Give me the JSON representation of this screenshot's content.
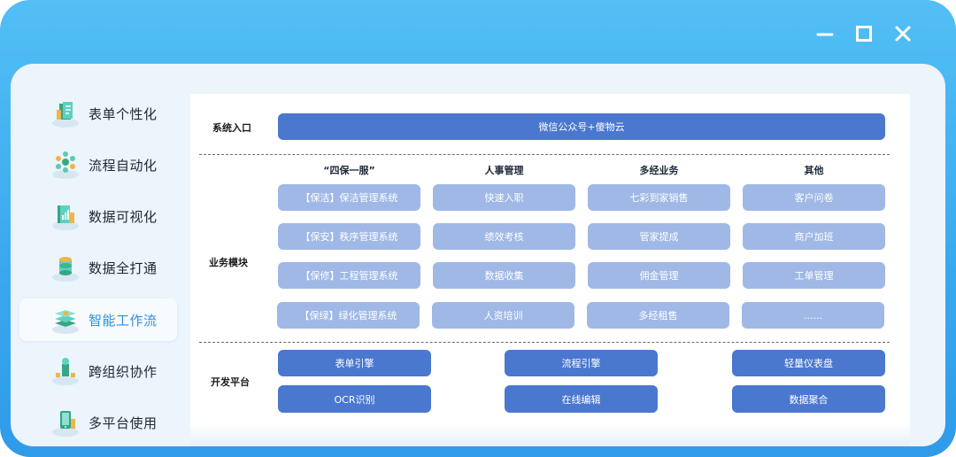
{
  "window_controls": {
    "minimize": "minimize-icon",
    "maximize": "maximize-icon",
    "close": "close-icon"
  },
  "sidebar": {
    "active_color": "#2f8ee6",
    "items": [
      {
        "label": "表单个性化",
        "icon": "form-icon"
      },
      {
        "label": "流程自动化",
        "icon": "workflow-nodes-icon"
      },
      {
        "label": "数据可视化",
        "icon": "chart-book-icon"
      },
      {
        "label": "数据全打通",
        "icon": "database-icon"
      },
      {
        "label": "智能工作流",
        "icon": "layers-icon",
        "active": true
      },
      {
        "label": "跨组织协作",
        "icon": "org-person-icon"
      },
      {
        "label": "多平台使用",
        "icon": "mobile-icon"
      }
    ]
  },
  "architecture": {
    "entry": {
      "label": "系统入口",
      "bar": "微信公众号+傻物云"
    },
    "business": {
      "label": "业务模块",
      "columns": [
        {
          "title": "“四保一服”",
          "items": [
            "【保洁】保洁管理系统",
            "【保安】秩序管理系统",
            "【保修】工程管理系统",
            "【保绿】绿化管理系统"
          ]
        },
        {
          "title": "人事管理",
          "items": [
            "快速入职",
            "绩效考核",
            "数据收集",
            "人资培训"
          ]
        },
        {
          "title": "多经业务",
          "items": [
            "七彩到家销售",
            "管家提成",
            "佣金管理",
            "多经租售"
          ]
        },
        {
          "title": "其他",
          "items": [
            "客户问卷",
            "商户加班",
            "工单管理",
            "......"
          ]
        }
      ]
    },
    "dev": {
      "label": "开发平台",
      "items": [
        "表单引擎",
        "流程引擎",
        "轻量仪表盘",
        "OCR识别",
        "在线编辑",
        "数据聚合"
      ]
    },
    "colors": {
      "dark_pill": "#4a78cf",
      "light_pill": "#9fb8e6"
    }
  }
}
